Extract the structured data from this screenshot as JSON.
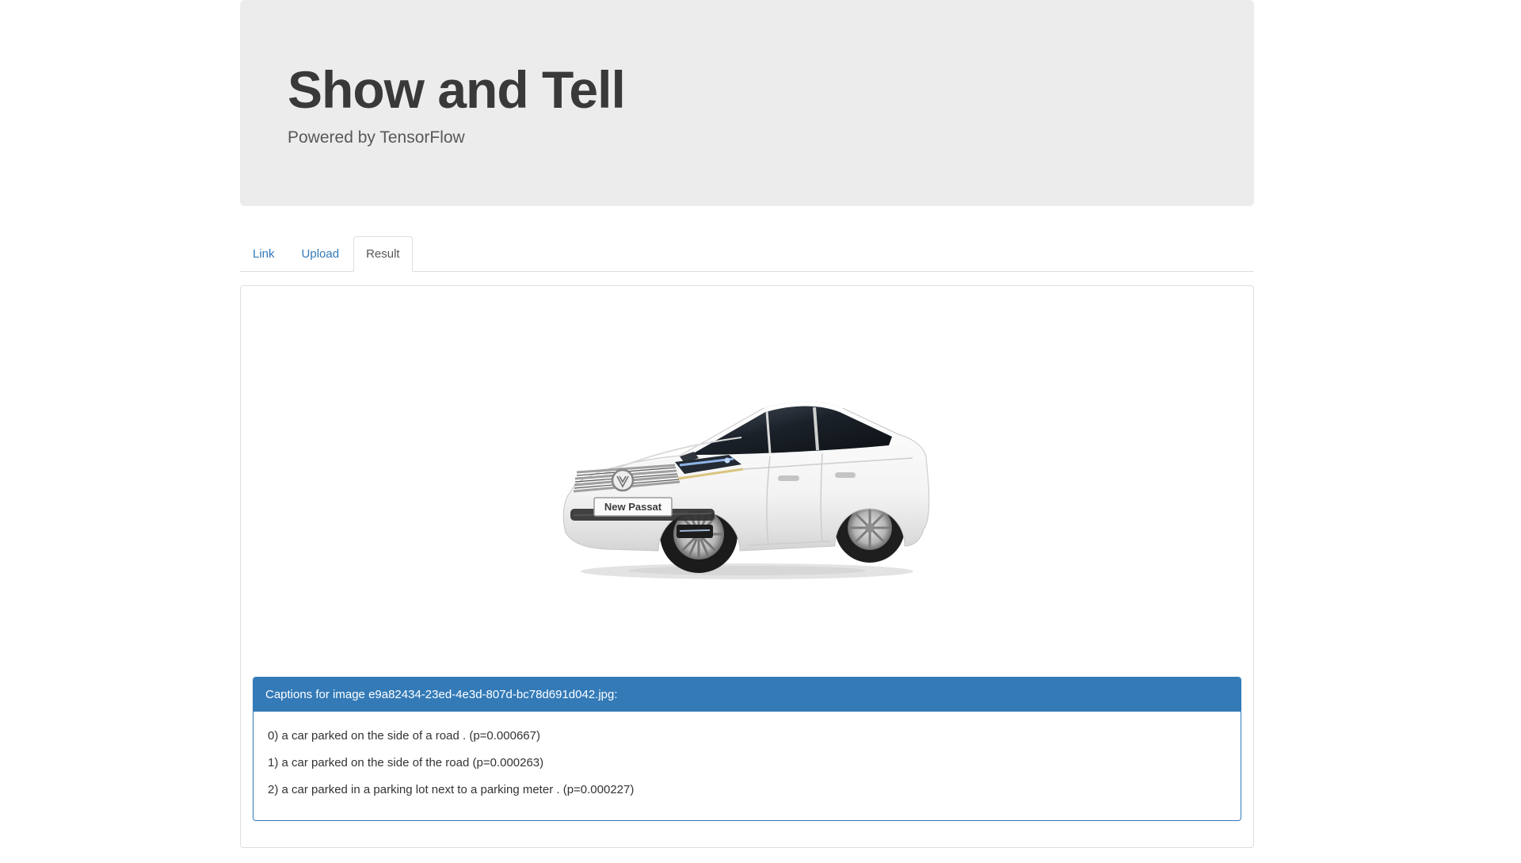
{
  "jumbotron": {
    "title": "Show and Tell",
    "subtitle": "Powered by TensorFlow"
  },
  "tabs": {
    "link": "Link",
    "upload": "Upload",
    "result": "Result",
    "active_tab": "Result"
  },
  "result_panel": {
    "image_description": "white Volkswagen New Passat sedan, three-quarter front view",
    "car_badge": "New Passat",
    "captions_title": "Captions for image e9a82434-23ed-4e3d-807d-bc78d691d042.jpg:",
    "captions": [
      "0) a car parked on the side of a road . (p=0.000667)",
      "1) a car parked on the side of the road (p=0.000263)",
      "2) a car parked in a parking lot next to a parking meter . (p=0.000227)"
    ]
  },
  "colors": {
    "accent": "#337ab7",
    "jumbotron_bg": "#ececec",
    "tab_border": "#dddddd"
  }
}
